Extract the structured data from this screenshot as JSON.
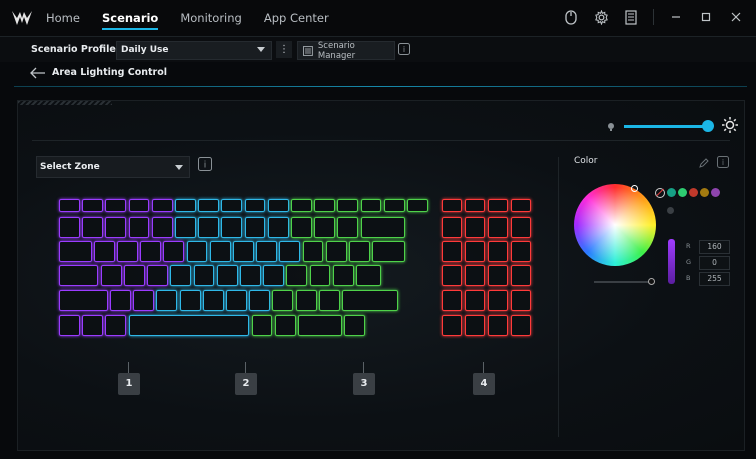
{
  "nav": {
    "tabs": [
      {
        "label": "Home",
        "active": false
      },
      {
        "label": "Scenario",
        "active": true
      },
      {
        "label": "Monitoring",
        "active": false
      },
      {
        "label": "App Center",
        "active": false
      }
    ],
    "icons": [
      "mouse-icon",
      "gear-icon",
      "notes-icon",
      "minimize-icon",
      "maximize-icon",
      "close-icon"
    ]
  },
  "profile": {
    "label": "Scenario Profile",
    "value": "Daily Use",
    "manager_label": "Scenario Manager"
  },
  "page": {
    "title": "Area Lighting Control"
  },
  "brightness": {
    "level": 1.0,
    "accent": "#1bb6e6"
  },
  "zone_select": {
    "value": "Select Zone"
  },
  "zones": [
    {
      "label": "1",
      "color": "#9b3cff"
    },
    {
      "label": "2",
      "color": "#2fb8e8"
    },
    {
      "label": "3",
      "color": "#4fd24a"
    },
    {
      "label": "4",
      "color": "#ff3a3a"
    }
  ],
  "color_panel": {
    "title": "Color",
    "swatches": [
      "#16a085",
      "#2ecc71",
      "#c0392b",
      "#a37a10",
      "#8e44ad"
    ],
    "rgb": [
      {
        "label": "R",
        "value": "160"
      },
      {
        "label": "G",
        "value": "0"
      },
      {
        "label": "B",
        "value": "255"
      }
    ]
  }
}
